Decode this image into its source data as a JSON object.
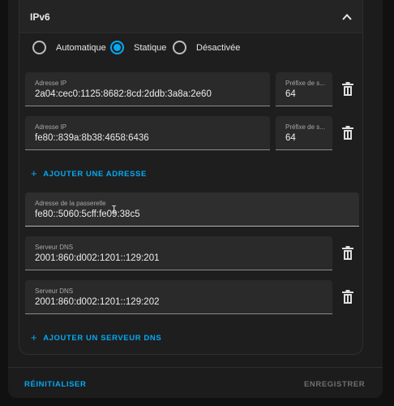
{
  "section": {
    "title": "IPv6"
  },
  "modes": [
    {
      "label": "Automatique",
      "checked": false
    },
    {
      "label": "Statique",
      "checked": true
    },
    {
      "label": "Désactivée",
      "checked": false
    }
  ],
  "addresses": [
    {
      "label": "Adresse IP",
      "value": "2a04:cec0:1125:8682:8cd:2ddb:3a8a:2e60",
      "prefix_label": "Préfixe de s...",
      "prefix_value": "64"
    },
    {
      "label": "Adresse IP",
      "value": "fe80::839a:8b38:4658:6436",
      "prefix_label": "Préfixe de s...",
      "prefix_value": "64"
    }
  ],
  "add_address_label": "AJOUTER UNE ADRESSE",
  "gateway": {
    "label": "Adresse de la passerelle",
    "value": "fe80::5060:5cff:fe09:38c5"
  },
  "dns": [
    {
      "label": "Serveur DNS",
      "value": "2001:860:d002:1201::129:201"
    },
    {
      "label": "Serveur DNS",
      "value": "2001:860:d002:1201::129:202"
    }
  ],
  "add_dns_label": "AJOUTER UN SERVEUR DNS",
  "footer": {
    "reset_label": "RÉINITIALISER",
    "save_label": "ENREGISTRER"
  },
  "colors": {
    "accent": "#03a9f4",
    "disabled": "#6f6f6f"
  },
  "icons": {
    "collapse": "chevron-up-icon",
    "delete": "trash-icon",
    "add": "plus-icon"
  }
}
